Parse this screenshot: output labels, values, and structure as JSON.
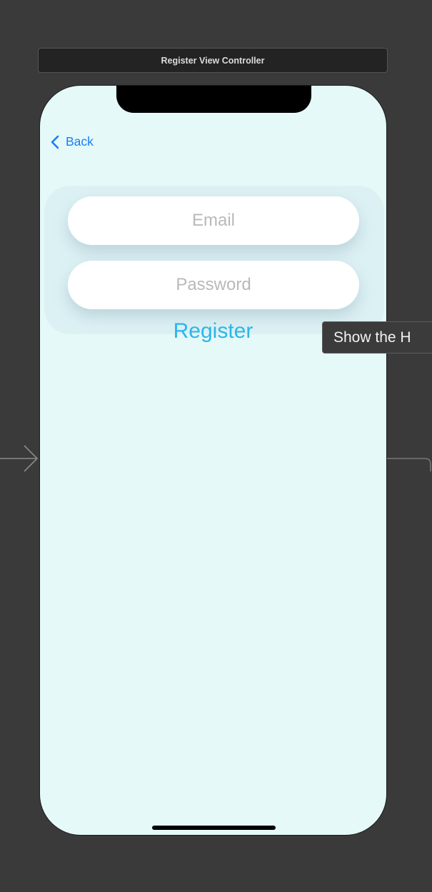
{
  "scene": {
    "title": "Register View Controller"
  },
  "screen": {
    "back_label": "Back",
    "email_placeholder": "Email",
    "password_placeholder": "Password",
    "register_label": "Register"
  },
  "tooltip": {
    "text": "Show the H"
  },
  "colors": {
    "canvas": "#3a3a3a",
    "screen_background": "#e5f9f8",
    "back_tint": "#157efb",
    "register_tint": "#2ab6ea",
    "placeholder": "#b9b9b9"
  },
  "icons": {
    "back": "chevron-left-icon",
    "entry": "entry-arrow-icon"
  }
}
